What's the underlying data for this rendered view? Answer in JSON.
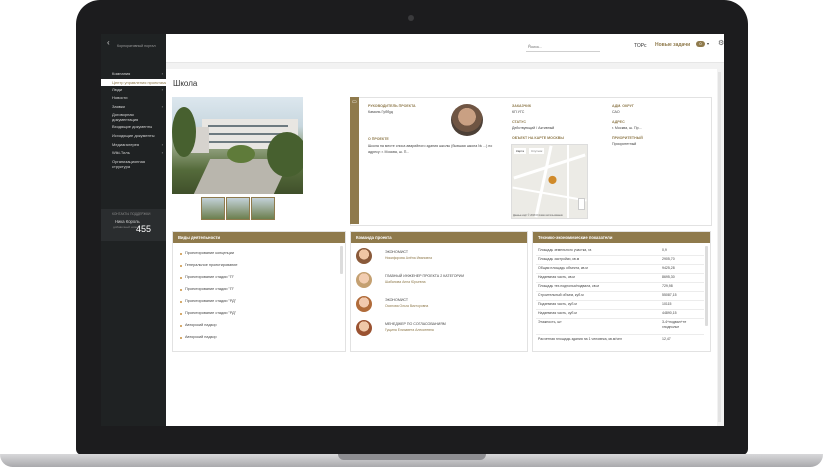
{
  "sidebar": {
    "back": "‹",
    "portal_title": "Корпоративный портал",
    "items": [
      {
        "label": "Компания",
        "arrow": "›"
      },
      {
        "label": "Центр управления проектами",
        "arrow": ""
      },
      {
        "label": "Люди",
        "arrow": "›"
      },
      {
        "label": "Новости",
        "arrow": ""
      },
      {
        "label": "Заявки",
        "arrow": "›"
      },
      {
        "label": "Договорная документация",
        "arrow": "›"
      },
      {
        "label": "Входящие документы",
        "arrow": ""
      },
      {
        "label": "Исходящие документы",
        "arrow": ""
      },
      {
        "label": "Медиагалерея",
        "arrow": "›"
      },
      {
        "label": "Wiki-Тиль",
        "arrow": "›"
      },
      {
        "label": "Организационная структура",
        "arrow": ""
      }
    ],
    "contact": {
      "label": "КОНТАКТЫ ПОДДЕРЖКИ",
      "name": "Ника Король",
      "sub": "добавочный номер",
      "number": "455"
    }
  },
  "header": {
    "search_placeholder": "Поиск...",
    "search_icon": "search-icon",
    "top_label": "ТОРс",
    "tasks_label": "Новые задачи",
    "tasks_count": "0",
    "caret": "▾",
    "gear": "⚙"
  },
  "page": {
    "title": "Школа"
  },
  "info": {
    "icon": "book-icon",
    "leader_label": "РУКОВОДИТЕЛЬ ПРОЕКТА",
    "leader_name": "Камиль Губбуд",
    "about_label": "О ПРОЕКТЕ",
    "about_text": "Школа на месте сноса аварийного здания школы (бывшая школа № ...) по адресу: г. Москва, ш. П...",
    "customer_label": "ЗАКАЗЧИК",
    "customer_value": "КП УГС",
    "status_label": "СТАТУС",
    "status_value": "Действующий / Активный",
    "map_label": "ОБЪЕКТ НА КАРТЕ МОСКВЫ",
    "district_label": "АДМ. ОКРУГ",
    "district_value": "САО",
    "address_label": "АДРЕС",
    "address_value": "г. Москва, ш. Пр...",
    "priority_label": "ПРИОРИТЕТНЫЙ",
    "priority_value": "Приоритетный",
    "map_tabs": [
      "Карта",
      "Спутник"
    ],
    "map_footer": "Данные карт © 2018   Условия использования"
  },
  "activities": {
    "title": "Виды деятельности",
    "items": [
      "Проектирование концепции",
      "Генеральное проектирование",
      "Проектирование стадии \"П\"",
      "Проектирование стадии \"П\"",
      "Проектирование стадии \"РД\"",
      "Проектирование стадии \"РД\"",
      "Авторский надзор",
      "Авторский надзор"
    ]
  },
  "team": {
    "title": "Команда проекта",
    "members": [
      {
        "role": "ЭКОНОМИСТ",
        "name": "Никифорова Алёна Ивановна"
      },
      {
        "role": "ГЛАВНЫЙ ИНЖЕНЕР ПРОЕКТА 2 КАТЕГОРИИ",
        "name": "Шабанова Анна Юрьевна"
      },
      {
        "role": "ЭКОНОМИСТ",
        "name": "Осипова Ольга Викторовна"
      },
      {
        "role": "МЕНЕДЖЕР ПО СОГЛАСОВАНИЯМ",
        "name": "Гущина Елизавета Алексеевна"
      }
    ]
  },
  "tech": {
    "title": "Технико-экономические показатели",
    "rows": [
      {
        "k": "Площадь земельного участка, га",
        "v": "0,9"
      },
      {
        "k": "Площадь застройки, кв.м",
        "v": "2905,70"
      },
      {
        "k": "Общая площадь объекта, кв.м",
        "v": "9425,28"
      },
      {
        "k": "Надземная часть, кв.м",
        "v": "8695,30"
      },
      {
        "k": "Площадь тех.подполья/подвала, кв.м",
        "v": "729,98"
      },
      {
        "k": "Строительный объем, куб.м",
        "v": "55087,15"
      },
      {
        "k": "Подземная часть, куб.м",
        "v": "10115"
      },
      {
        "k": "Надземная часть, куб.м",
        "v": "44890,15"
      },
      {
        "k": "Этажность, шт",
        "v": "3-4+подвал+те хподполье"
      },
      {
        "k": "Расчетная площадь здания на 1 человека, кв.м/чел",
        "v": "12,47"
      }
    ]
  }
}
